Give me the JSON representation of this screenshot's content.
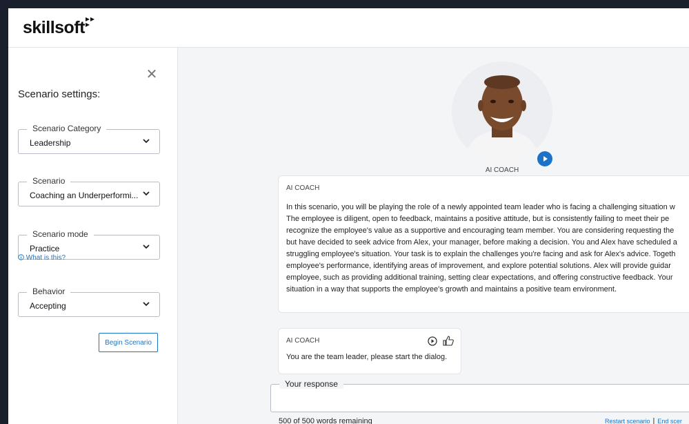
{
  "app": {
    "logo_text": "skillsoft"
  },
  "sidebar": {
    "title": "Scenario settings:",
    "fields": [
      {
        "label": "Scenario Category",
        "value": "Leadership"
      },
      {
        "label": "Scenario",
        "value": "Coaching an Underperformi..."
      },
      {
        "label": "Scenario mode",
        "value": "Practice"
      },
      {
        "label": "Behavior",
        "value": "Accepting"
      }
    ],
    "help_link": "What is this?",
    "begin_button": "Begin Scenario"
  },
  "main": {
    "avatar_caption": "AI COACH",
    "intro_card": {
      "title": "AI COACH",
      "lines": [
        "In this scenario, you will be playing the role of a newly appointed team leader who is facing a challenging situation w",
        "The employee is diligent, open to feedback, maintains a positive attitude, but is consistently failing to meet their pe",
        "recognize the employee's value as a supportive and encouraging team member. You are considering requesting the",
        "but have decided to seek advice from Alex, your manager, before making a decision. You and Alex have scheduled a",
        "struggling employee's situation. Your task is to explain the challenges you're facing and ask for Alex's advice. Togeth",
        "employee's performance, identifying areas of improvement, and explore potential solutions. Alex will provide guidar",
        "employee, such as providing additional training, setting clear expectations, and offering constructive feedback. Your",
        "situation in a way that supports the employee's growth and maintains a positive team environment."
      ]
    },
    "message_card": {
      "title": "AI COACH",
      "message": "You are the team leader, please start the dialog."
    },
    "response": {
      "label": "Your response",
      "words_remaining": "500 of 500 words remaining",
      "restart_link": "Restart scenario",
      "separator": "|",
      "end_link": "End scer"
    }
  },
  "colors": {
    "accent": "#1a73c9",
    "page_bg": "#f4f5f7",
    "frame": "#1a1f2e"
  }
}
